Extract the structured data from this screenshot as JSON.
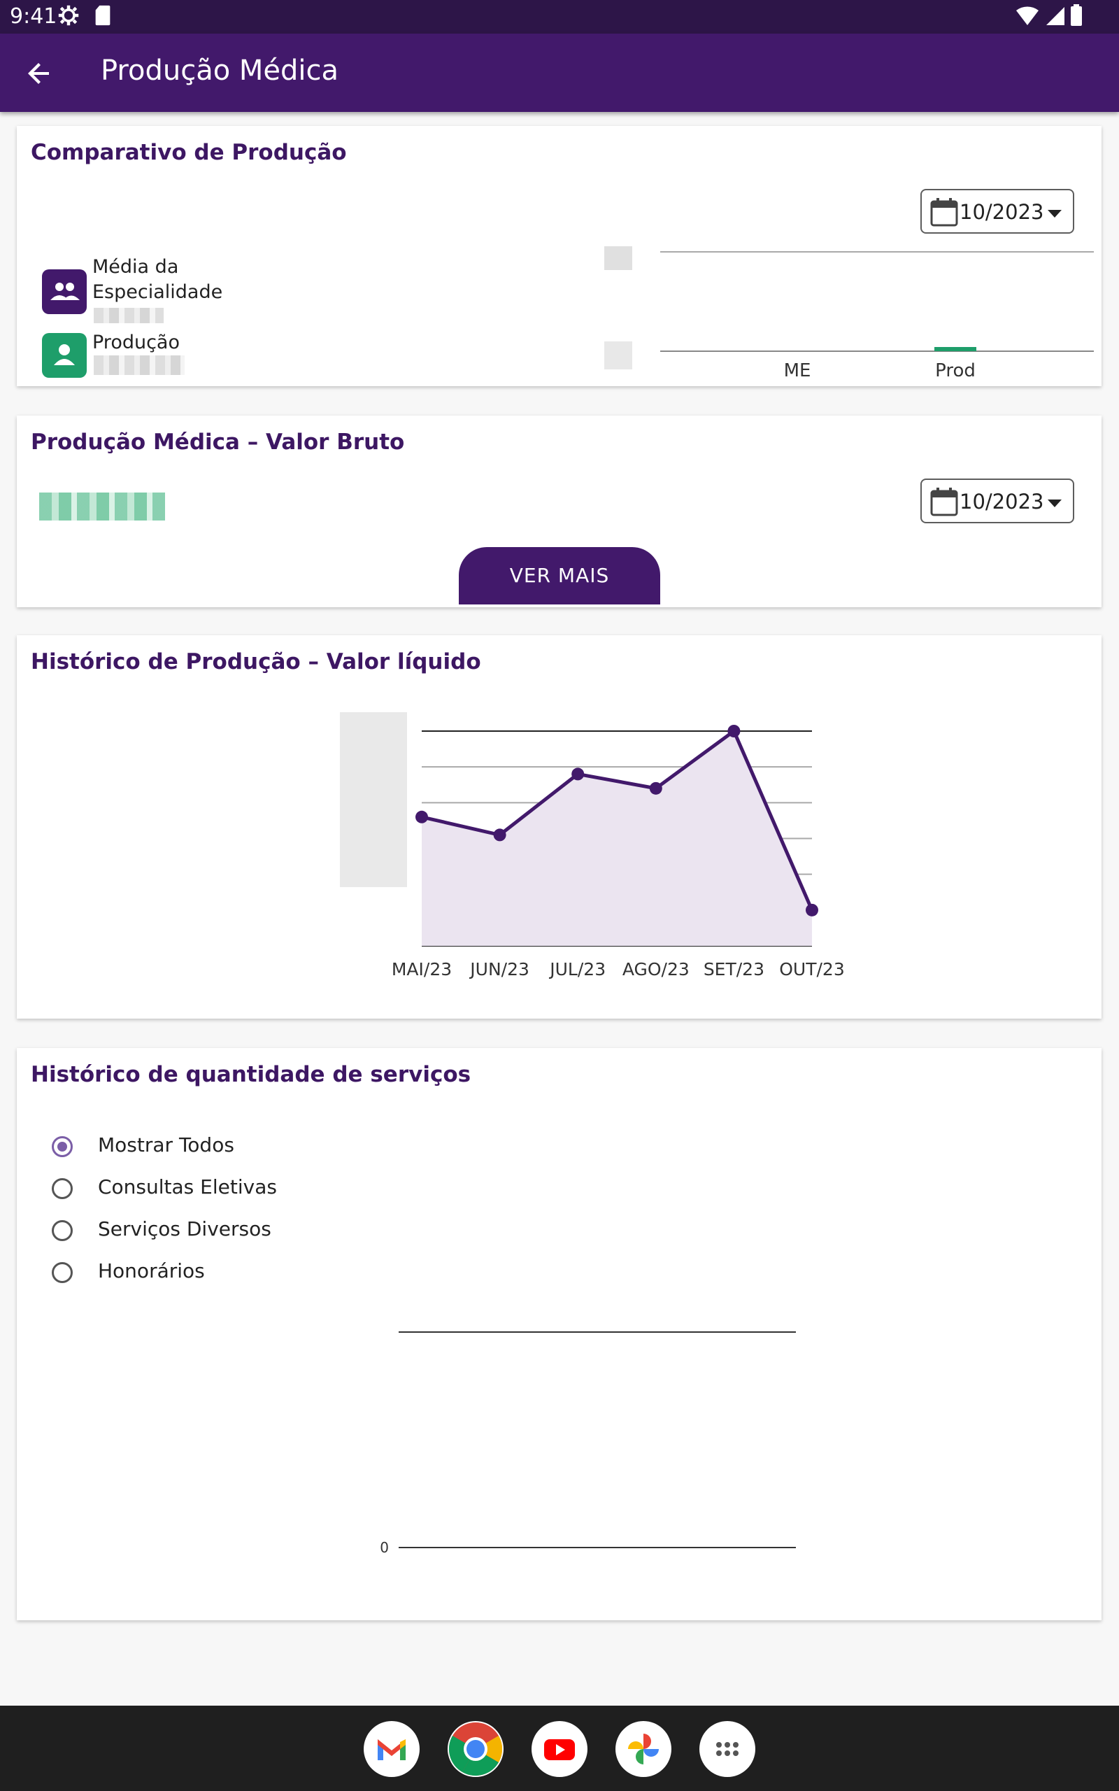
{
  "status_bar": {
    "time": "9:41"
  },
  "app_bar": {
    "title": "Produção Médica"
  },
  "comparativo": {
    "title": "Comparativo de Produção",
    "date": "10/2023",
    "legend": [
      {
        "label": "Média da Especialidade",
        "color": "#42196b",
        "icon": "group-icon"
      },
      {
        "label": "Produção",
        "color": "#1e9e6a",
        "icon": "person-icon"
      }
    ],
    "chart_data": {
      "type": "bar",
      "categories": [
        "ME",
        "Prod"
      ],
      "values": [
        0,
        0
      ],
      "colors": [
        "#42196b",
        "#1e9e6a"
      ]
    }
  },
  "valor_bruto": {
    "title": "Produção Médica – Valor Bruto",
    "date": "10/2023",
    "button": "VER MAIS"
  },
  "historico_liquido": {
    "title": "Histórico de Produção – Valor líquido",
    "chart_data": {
      "type": "area",
      "categories": [
        "MAI/23",
        "JUN/23",
        "JUL/23",
        "AGO/23",
        "SET/23",
        "OUT/23"
      ],
      "values": [
        3.6,
        3.1,
        4.8,
        4.4,
        6.0,
        1.0
      ],
      "ylim": [
        0,
        6
      ],
      "grid": true,
      "line_color": "#42196b",
      "fill_color": "#ebe4f0"
    }
  },
  "historico_servicos": {
    "title": "Histórico de quantidade de serviços",
    "options": [
      "Mostrar Todos",
      "Consultas Eletivas",
      "Serviços Diversos",
      "Honorários"
    ],
    "selected": 0,
    "chart_data": {
      "type": "bar",
      "categories": [],
      "values": [],
      "y_ticks": [
        "0"
      ]
    }
  },
  "dock": {
    "apps": [
      "gmail-icon",
      "chrome-icon",
      "youtube-icon",
      "photos-icon",
      "app-drawer-icon"
    ]
  }
}
